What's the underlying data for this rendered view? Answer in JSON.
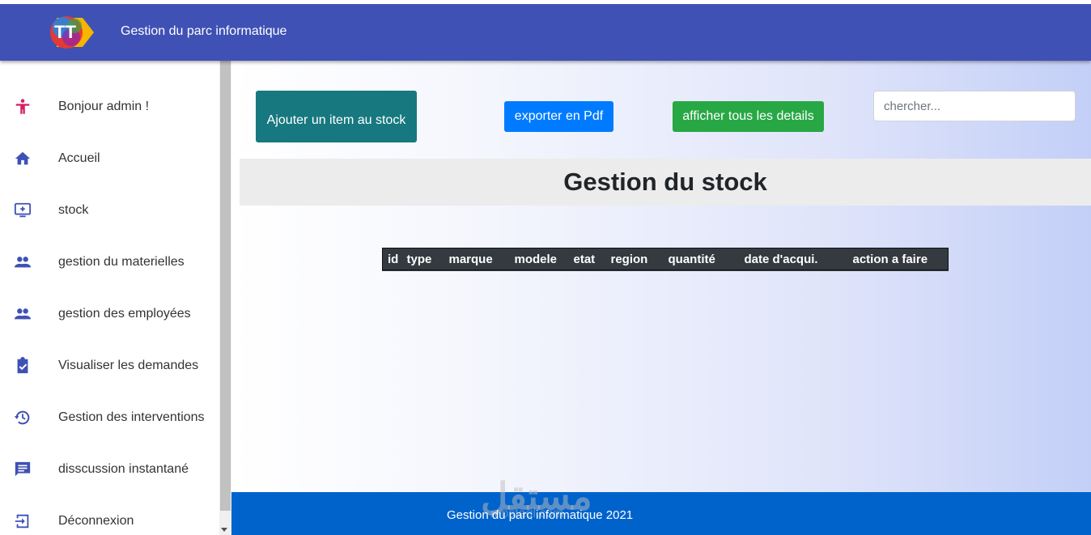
{
  "header": {
    "title": "Gestion du parc informatique",
    "logo_text": "TT",
    "logo_icon": "tunisie-telecom-logo"
  },
  "sidebar": {
    "items": [
      {
        "label": "Bonjour admin !",
        "icon": "person-icon",
        "color": "#d81b60"
      },
      {
        "label": "Accueil",
        "icon": "home-icon",
        "color": "#3f51b5"
      },
      {
        "label": "stock",
        "icon": "monitor-add-icon",
        "color": "#3f51b5"
      },
      {
        "label": "gestion du materielles",
        "icon": "group-icon",
        "color": "#3f51b5"
      },
      {
        "label": "gestion des employées",
        "icon": "group-icon",
        "color": "#3f51b5"
      },
      {
        "label": "Visualiser les demandes",
        "icon": "clipboard-check-icon",
        "color": "#3f51b5"
      },
      {
        "label": "Gestion des interventions",
        "icon": "history-icon",
        "color": "#3f51b5"
      },
      {
        "label": "disscussion instantané",
        "icon": "chat-icon",
        "color": "#3f51b5"
      },
      {
        "label": "Déconnexion",
        "icon": "logout-icon",
        "color": "#3f51b5"
      }
    ]
  },
  "toolbar": {
    "add_label": "Ajouter un item au stock",
    "pdf_label": "exporter en Pdf",
    "details_label": "afficher tous les details",
    "search_placeholder": "chercher...",
    "search_value": ""
  },
  "main": {
    "heading": "Gestion du stock"
  },
  "table": {
    "columns": [
      "id",
      "type",
      "marque",
      "modele",
      "etat",
      "region",
      "quantité",
      "date d'acqui.",
      "action a faire"
    ],
    "rows": []
  },
  "footer": {
    "text": "Gestion du parc informatique 2021",
    "watermark": "مستقل",
    "watermark_sub": "mostaql.com"
  },
  "colors": {
    "topbar": "#3f51b5",
    "add_button": "#17787f",
    "pdf_button": "#007bff",
    "details_button": "#28a745",
    "footer": "#0063cc",
    "table_header": "#343a40"
  }
}
